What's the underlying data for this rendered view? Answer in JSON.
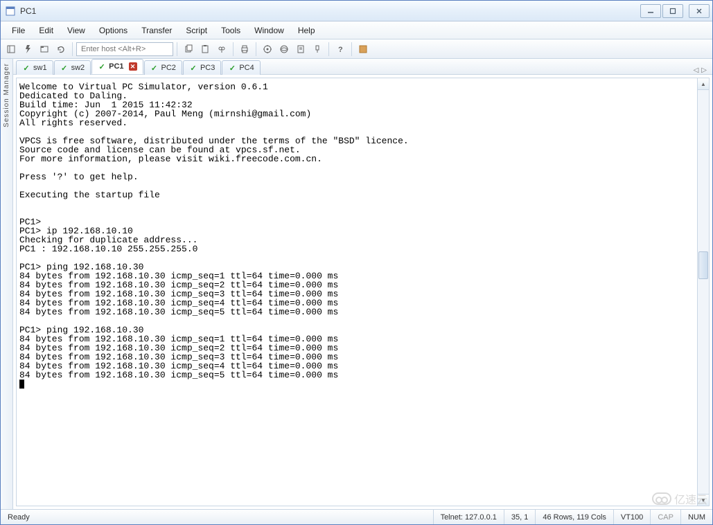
{
  "window": {
    "title": "PC1"
  },
  "menubar": {
    "items": [
      "File",
      "Edit",
      "View",
      "Options",
      "Transfer",
      "Script",
      "Tools",
      "Window",
      "Help"
    ]
  },
  "toolbar": {
    "host_placeholder": "Enter host <Alt+R>"
  },
  "sidebar": {
    "label": "Session Manager"
  },
  "tabs": {
    "items": [
      {
        "label": "sw1",
        "active": false,
        "hasClose": false
      },
      {
        "label": "sw2",
        "active": false,
        "hasClose": false
      },
      {
        "label": "PC1",
        "active": true,
        "hasClose": true
      },
      {
        "label": "PC2",
        "active": false,
        "hasClose": false
      },
      {
        "label": "PC3",
        "active": false,
        "hasClose": false
      },
      {
        "label": "PC4",
        "active": false,
        "hasClose": false
      }
    ]
  },
  "terminal": {
    "lines": [
      "Welcome to Virtual PC Simulator, version 0.6.1",
      "Dedicated to Daling.",
      "Build time: Jun  1 2015 11:42:32",
      "Copyright (c) 2007-2014, Paul Meng (mirnshi@gmail.com)",
      "All rights reserved.",
      "",
      "VPCS is free software, distributed under the terms of the \"BSD\" licence.",
      "Source code and license can be found at vpcs.sf.net.",
      "For more information, please visit wiki.freecode.com.cn.",
      "",
      "Press '?' to get help.",
      "",
      "Executing the startup file",
      "",
      "",
      "PC1>",
      "PC1> ip 192.168.10.10",
      "Checking for duplicate address...",
      "PC1 : 192.168.10.10 255.255.255.0",
      "",
      "PC1> ping 192.168.10.30",
      "84 bytes from 192.168.10.30 icmp_seq=1 ttl=64 time=0.000 ms",
      "84 bytes from 192.168.10.30 icmp_seq=2 ttl=64 time=0.000 ms",
      "84 bytes from 192.168.10.30 icmp_seq=3 ttl=64 time=0.000 ms",
      "84 bytes from 192.168.10.30 icmp_seq=4 ttl=64 time=0.000 ms",
      "84 bytes from 192.168.10.30 icmp_seq=5 ttl=64 time=0.000 ms",
      "",
      "PC1> ping 192.168.10.30",
      "84 bytes from 192.168.10.30 icmp_seq=1 ttl=64 time=0.000 ms",
      "84 bytes from 192.168.10.30 icmp_seq=2 ttl=64 time=0.000 ms",
      "84 bytes from 192.168.10.30 icmp_seq=3 ttl=64 time=0.000 ms",
      "84 bytes from 192.168.10.30 icmp_seq=4 ttl=64 time=0.000 ms",
      "84 bytes from 192.168.10.30 icmp_seq=5 ttl=64 time=0.000 ms"
    ]
  },
  "statusbar": {
    "ready": "Ready",
    "telnet": "Telnet: 127.0.0.1",
    "rowcol": "35,   1",
    "size": "46 Rows, 119 Cols",
    "emu": "VT100",
    "cap": "CAP",
    "num": "NUM"
  },
  "watermark": {
    "text": "亿速云"
  }
}
